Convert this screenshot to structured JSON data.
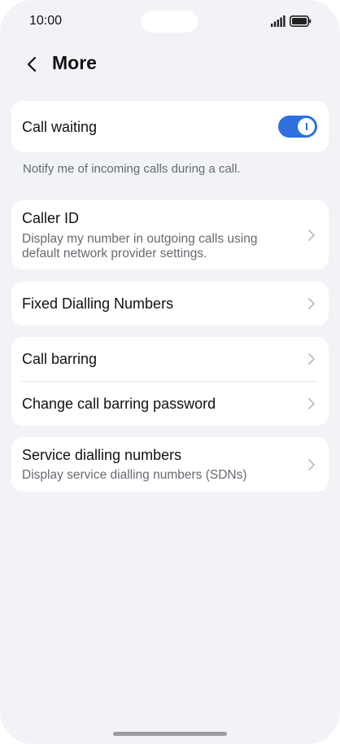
{
  "status_bar": {
    "time": "10:00"
  },
  "header": {
    "title": "More"
  },
  "call_waiting": {
    "label": "Call waiting",
    "enabled": true,
    "helper": "Notify me of incoming calls during a call."
  },
  "caller_id": {
    "label": "Caller ID",
    "sublabel": "Display my number in outgoing calls using default network provider settings."
  },
  "fixed_dialling": {
    "label": "Fixed Dialling Numbers"
  },
  "call_barring": {
    "label": "Call barring",
    "change_password_label": "Change call barring password"
  },
  "service_dialling": {
    "label": "Service dialling numbers",
    "sublabel": "Display service dialling numbers (SDNs)"
  },
  "colors": {
    "accent": "#2f6fe0",
    "background": "#f1f3f6",
    "card": "#ffffff"
  }
}
